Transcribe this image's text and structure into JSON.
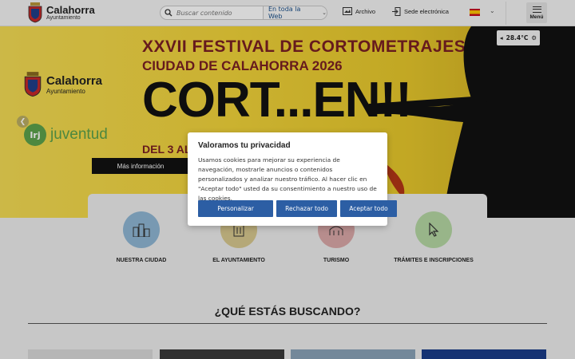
{
  "header": {
    "logo_title": "Calahorra",
    "logo_sub": "Ayuntamiento",
    "search_placeholder": "Buscar contenido",
    "search_scope": "En toda la Web",
    "archive_label": "Archivo",
    "sede_label": "Sede electrónica",
    "menu_label": "Menú",
    "icons": [
      "search-icon",
      "archive-icon",
      "login-icon",
      "chevron-down-icon",
      "hamburger-icon"
    ]
  },
  "banner": {
    "logo_title": "Calahorra",
    "logo_sub": "Ayuntamiento",
    "irj_badge": "Irj",
    "irj_text": "juventud",
    "festival_line1": "XXVII FESTIVAL DE CORTOMETRAJES",
    "festival_line2": "CIUDAD DE CALAHORRA 2026",
    "festival_line3": "CORT...EN!!",
    "festival_line4": "DEL 3 AL 6",
    "more_button": "Más información",
    "temperature": "28.4°C"
  },
  "categories": [
    {
      "label": "NUESTRA CIUDAD",
      "color": "#8fb7d4",
      "icon": "city-icon"
    },
    {
      "label": "EL AYUNTAMIENTO",
      "color": "#d8c98f",
      "icon": "building-icon"
    },
    {
      "label": "TURISMO",
      "color": "#dba9a9",
      "icon": "monument-icon"
    },
    {
      "label": "TRÁMITES E INSCRIPCIONES",
      "color": "#b5d8a4",
      "icon": "cursor-icon"
    }
  ],
  "section": {
    "heading": "¿QUÉ ESTÁS BUSCANDO?"
  },
  "cookie_dialog": {
    "title": "Valoramos tu privacidad",
    "text": "Usamos cookies para mejorar su experiencia de navegación, mostrarle anuncios o contenidos personalizados y analizar nuestro tráfico. Al hacer clic en \"Aceptar todo\" usted da su consentimiento a nuestro uso de las cookies.",
    "customize": "Personalizar",
    "reject": "Rechazar todo",
    "accept": "Aceptar todo",
    "button_color": "#2c5ea4"
  }
}
